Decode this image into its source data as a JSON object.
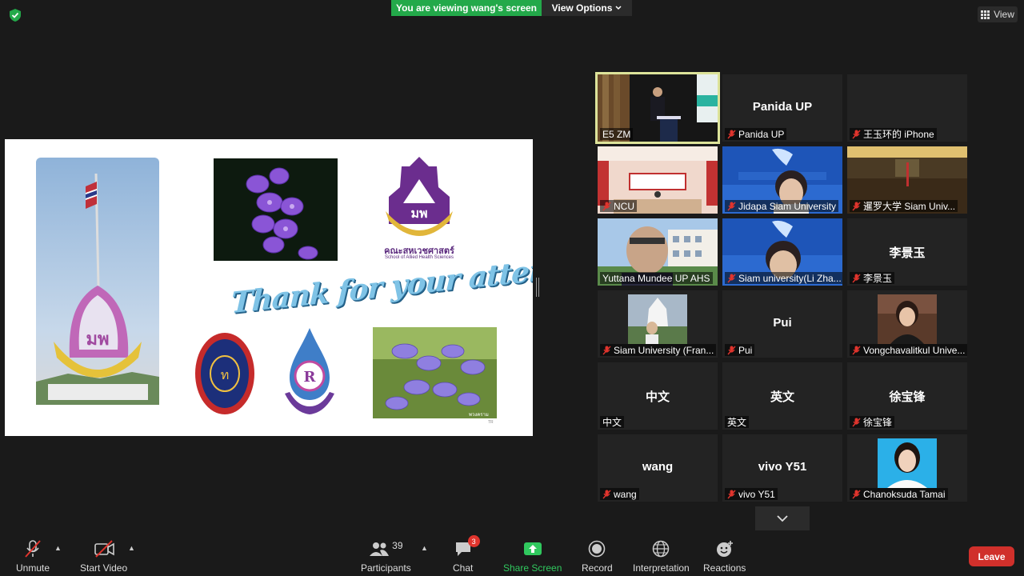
{
  "banner": {
    "viewing": "You are viewing wang's screen",
    "view_options": "View Options",
    "view": "View"
  },
  "slide": {
    "thank_text": "Thank for your attention",
    "faculty_logo_thai": "คณะสหเวชศาสตร์",
    "faculty_logo_english": "School of Allied Health Sciences",
    "orchid_photo_tag": "พวงคราม",
    "corner_mark": "TR"
  },
  "tiles": [
    {
      "label": "E5 ZM",
      "muted": false,
      "active": true,
      "kind": "video-stage"
    },
    {
      "big": "Panida UP",
      "label": "Panida UP",
      "muted": true
    },
    {
      "big": "",
      "label": "王玉环的 iPhone",
      "muted": true
    },
    {
      "label": "NCU",
      "muted": true,
      "kind": "video-hall"
    },
    {
      "label": "Jidapa Siam University",
      "muted": true,
      "kind": "video-banner"
    },
    {
      "label": "暹罗大学 Siam Univ...",
      "muted": true,
      "kind": "video-room"
    },
    {
      "label": "Yuttana Mundee UP AHS",
      "muted": false,
      "kind": "video-man"
    },
    {
      "label": "Siam university(Li Zha...",
      "muted": true,
      "kind": "video-banner2"
    },
    {
      "big": "李景玉",
      "label": "李景玉",
      "muted": true
    },
    {
      "label": "Siam University (Fran...",
      "muted": true,
      "kind": "photo-temple"
    },
    {
      "big": "Pui",
      "label": "Pui",
      "muted": true
    },
    {
      "label": "Vongchavalitkul Unive...",
      "muted": true,
      "kind": "photo-woman"
    },
    {
      "big": "中文",
      "label": "中文",
      "muted": false
    },
    {
      "big": "英文",
      "label": "英文",
      "muted": false
    },
    {
      "big": "徐宝锋",
      "label": "徐宝锋",
      "muted": true
    },
    {
      "big": "wang",
      "label": "wang",
      "muted": true
    },
    {
      "big": "vivo Y51",
      "label": "vivo Y51",
      "muted": true
    },
    {
      "label": "Chanoksuda Tamai",
      "muted": true,
      "kind": "photo-portrait"
    }
  ],
  "toolbar": {
    "unmute": "Unmute",
    "start_video": "Start Video",
    "participants": "Participants",
    "participants_count": "39",
    "chat": "Chat",
    "chat_badge": "3",
    "share_screen": "Share Screen",
    "record": "Record",
    "interpretation": "Interpretation",
    "reactions": "Reactions",
    "leave": "Leave"
  },
  "colors": {
    "viewing_banner": "#23a94a",
    "active_speaker_border": "#dde39a",
    "leave": "#d0302b",
    "muted_mic": "#e0342d",
    "share_green": "#30c85e"
  }
}
